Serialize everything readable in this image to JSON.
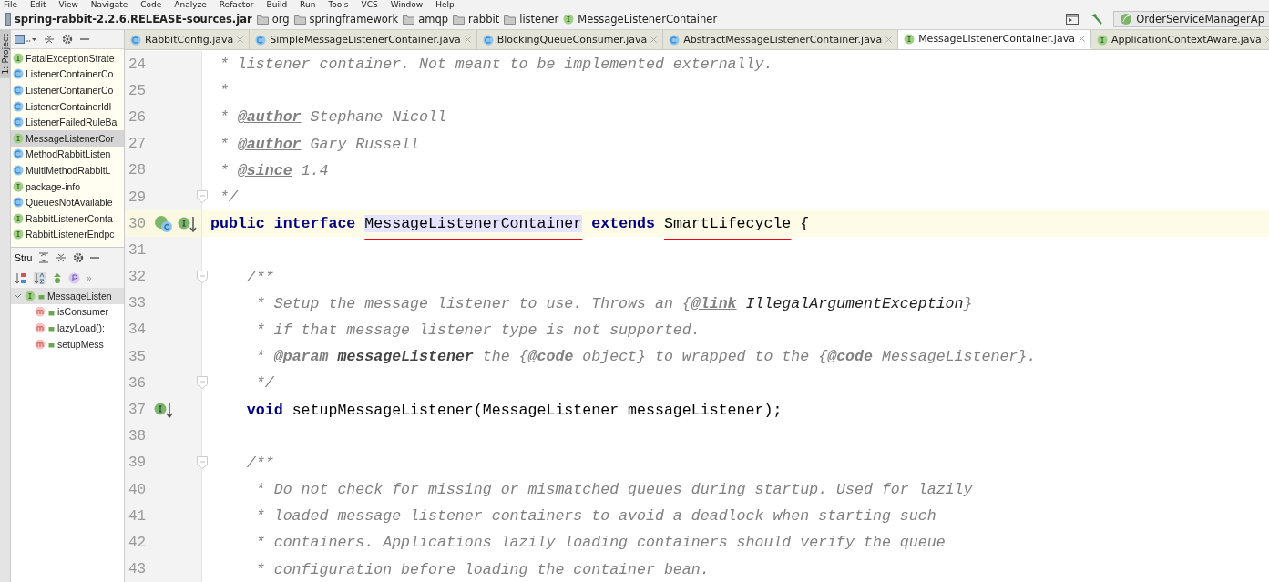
{
  "menu_bar": [
    "File",
    "Edit",
    "View",
    "Navigate",
    "Code",
    "Analyze",
    "Refactor",
    "Build",
    "Run",
    "Tools",
    "VCS",
    "Window",
    "Help"
  ],
  "breadcrumbs": [
    {
      "label": "spring-rabbit-2.2.6.RELEASE-sources.jar",
      "kind": "jar"
    },
    {
      "label": "org",
      "kind": "folder"
    },
    {
      "label": "springframework",
      "kind": "folder"
    },
    {
      "label": "amqp",
      "kind": "folder"
    },
    {
      "label": "rabbit",
      "kind": "folder"
    },
    {
      "label": "listener",
      "kind": "folder"
    },
    {
      "label": "MessageListenerContainer",
      "kind": "interface"
    }
  ],
  "run_config": "OrderServiceManagerAp",
  "tool_window_tab": "1: Project",
  "tabs": [
    {
      "label": "RabbitConfig.java",
      "kind": "class",
      "selected": false
    },
    {
      "label": "SimpleMessageListenerContainer.java",
      "kind": "class",
      "selected": false
    },
    {
      "label": "BlockingQueueConsumer.java",
      "kind": "class",
      "selected": false
    },
    {
      "label": "AbstractMessageListenerContainer.java",
      "kind": "class",
      "selected": false
    },
    {
      "label": "MessageListenerContainer.java",
      "kind": "interface",
      "selected": true
    },
    {
      "label": "ApplicationContextAware.java",
      "kind": "interface",
      "selected": false
    }
  ],
  "project_items": [
    {
      "label": "FatalExceptionStrate",
      "kind": "interface",
      "selected": false
    },
    {
      "label": "ListenerContainerCo",
      "kind": "class",
      "selected": false
    },
    {
      "label": "ListenerContainerCo",
      "kind": "class",
      "selected": false
    },
    {
      "label": "ListenerContainerIdl",
      "kind": "class",
      "selected": false
    },
    {
      "label": "ListenerFailedRuleBa",
      "kind": "class",
      "selected": false
    },
    {
      "label": "MessageListenerCor",
      "kind": "interface",
      "selected": true
    },
    {
      "label": "MethodRabbitListen",
      "kind": "class",
      "selected": false
    },
    {
      "label": "MultiMethodRabbitL",
      "kind": "class",
      "selected": false
    },
    {
      "label": "package-info",
      "kind": "interface",
      "selected": false
    },
    {
      "label": "QueuesNotAvailable",
      "kind": "class",
      "selected": false
    },
    {
      "label": "RabbitListenerConta",
      "kind": "interface",
      "selected": false
    },
    {
      "label": "RabbitListenerEndpc",
      "kind": "interface",
      "selected": false
    }
  ],
  "structure": {
    "title": "Stru",
    "more": "»",
    "root": {
      "label": "MessageListen",
      "kind": "interface",
      "expanded": true,
      "children": [
        {
          "label": "isConsumer",
          "kind": "method"
        },
        {
          "label": "lazyLoad():",
          "kind": "method"
        },
        {
          "label": "setupMess",
          "kind": "method"
        }
      ]
    }
  },
  "lines": [
    {
      "number": "24",
      "current": false,
      "fold": false,
      "tokens": [
        {
          "text": " * listener container. Not meant to be implemented externally.",
          "kind": "comment"
        }
      ]
    },
    {
      "number": "25",
      "current": false,
      "fold": false,
      "tokens": [
        {
          "text": " *",
          "kind": "comment"
        }
      ]
    },
    {
      "number": "26",
      "current": false,
      "fold": false,
      "tokens": [
        {
          "text": " * ",
          "kind": "comment"
        },
        {
          "text": "@author",
          "kind": "tag"
        },
        {
          "text": " Stephane Nicoll",
          "kind": "comment"
        }
      ]
    },
    {
      "number": "27",
      "current": false,
      "fold": false,
      "tokens": [
        {
          "text": " * ",
          "kind": "comment"
        },
        {
          "text": "@author",
          "kind": "tag"
        },
        {
          "text": " Gary Russell",
          "kind": "comment"
        }
      ]
    },
    {
      "number": "28",
      "current": false,
      "fold": false,
      "tokens": [
        {
          "text": " * ",
          "kind": "comment"
        },
        {
          "text": "@since",
          "kind": "tag"
        },
        {
          "text": " 1.4",
          "kind": "comment"
        }
      ]
    },
    {
      "number": "29",
      "current": false,
      "fold": true,
      "tokens": [
        {
          "text": " */",
          "kind": "comment"
        }
      ]
    },
    {
      "number": "30",
      "current": true,
      "fold": false,
      "gutter_icons": [
        {
          "kind": "implemented"
        },
        {
          "kind": "interface-down"
        }
      ],
      "tokens": [
        {
          "text": "public interface ",
          "kind": "keyword"
        },
        {
          "text": "MessageListenerContainer",
          "kind": "highlight",
          "marked": true
        },
        {
          "text": " extends ",
          "kind": "keyword"
        },
        {
          "text": "SmartLifecycle",
          "kind": "plain",
          "marked": true
        },
        {
          "text": " {",
          "kind": "plain"
        }
      ]
    },
    {
      "number": "31",
      "current": false,
      "fold": false
    },
    {
      "number": "32",
      "current": false,
      "fold": true,
      "tokens": [
        {
          "text": "    /**",
          "kind": "comment"
        }
      ]
    },
    {
      "number": "33",
      "current": false,
      "fold": false,
      "tokens": [
        {
          "text": "     * Setup the message listener to use. Throws an {",
          "kind": "comment"
        },
        {
          "text": "@link",
          "kind": "tag"
        },
        {
          "text": " IllegalArgumentException",
          "kind": "doc-ref"
        },
        {
          "text": "}",
          "kind": "comment"
        }
      ]
    },
    {
      "number": "34",
      "current": false,
      "fold": false,
      "tokens": [
        {
          "text": "     * if that message listener type is not supported.",
          "kind": "comment"
        }
      ]
    },
    {
      "number": "35",
      "current": false,
      "fold": false,
      "tokens": [
        {
          "text": "     * ",
          "kind": "comment"
        },
        {
          "text": "@param",
          "kind": "tag"
        },
        {
          "text": " messageListener",
          "kind": "doc-param"
        },
        {
          "text": " the {",
          "kind": "comment"
        },
        {
          "text": "@code",
          "kind": "tag"
        },
        {
          "text": " object} to wrapped to the {",
          "kind": "comment"
        },
        {
          "text": "@code",
          "kind": "tag"
        },
        {
          "text": " MessageListener}.",
          "kind": "comment"
        }
      ]
    },
    {
      "number": "36",
      "current": false,
      "fold": true,
      "tokens": [
        {
          "text": "     */",
          "kind": "comment"
        }
      ]
    },
    {
      "number": "37",
      "current": false,
      "fold": false,
      "gutter_icons": [
        {
          "kind": "interface-down"
        }
      ],
      "tokens": [
        {
          "text": "    void",
          "kind": "keyword"
        },
        {
          "text": " setupMessageListener(MessageListener messageListener);",
          "kind": "plain"
        }
      ]
    },
    {
      "number": "38",
      "current": false,
      "fold": false
    },
    {
      "number": "39",
      "current": false,
      "fold": true,
      "tokens": [
        {
          "text": "    /**",
          "kind": "comment"
        }
      ]
    },
    {
      "number": "40",
      "current": false,
      "fold": false,
      "tokens": [
        {
          "text": "     * Do not check for missing or mismatched queues during startup. Used for lazily",
          "kind": "comment"
        }
      ]
    },
    {
      "number": "41",
      "current": false,
      "fold": false,
      "tokens": [
        {
          "text": "     * loaded message listener containers to avoid a deadlock when starting such",
          "kind": "comment"
        }
      ]
    },
    {
      "number": "42",
      "current": false,
      "fold": false,
      "tokens": [
        {
          "text": "     * containers. Applications lazily loading containers should verify the queue",
          "kind": "comment"
        }
      ]
    },
    {
      "number": "43",
      "current": false,
      "fold": false,
      "tokens": [
        {
          "text": "     * configuration before loading the container bean.",
          "kind": "comment"
        }
      ]
    }
  ]
}
